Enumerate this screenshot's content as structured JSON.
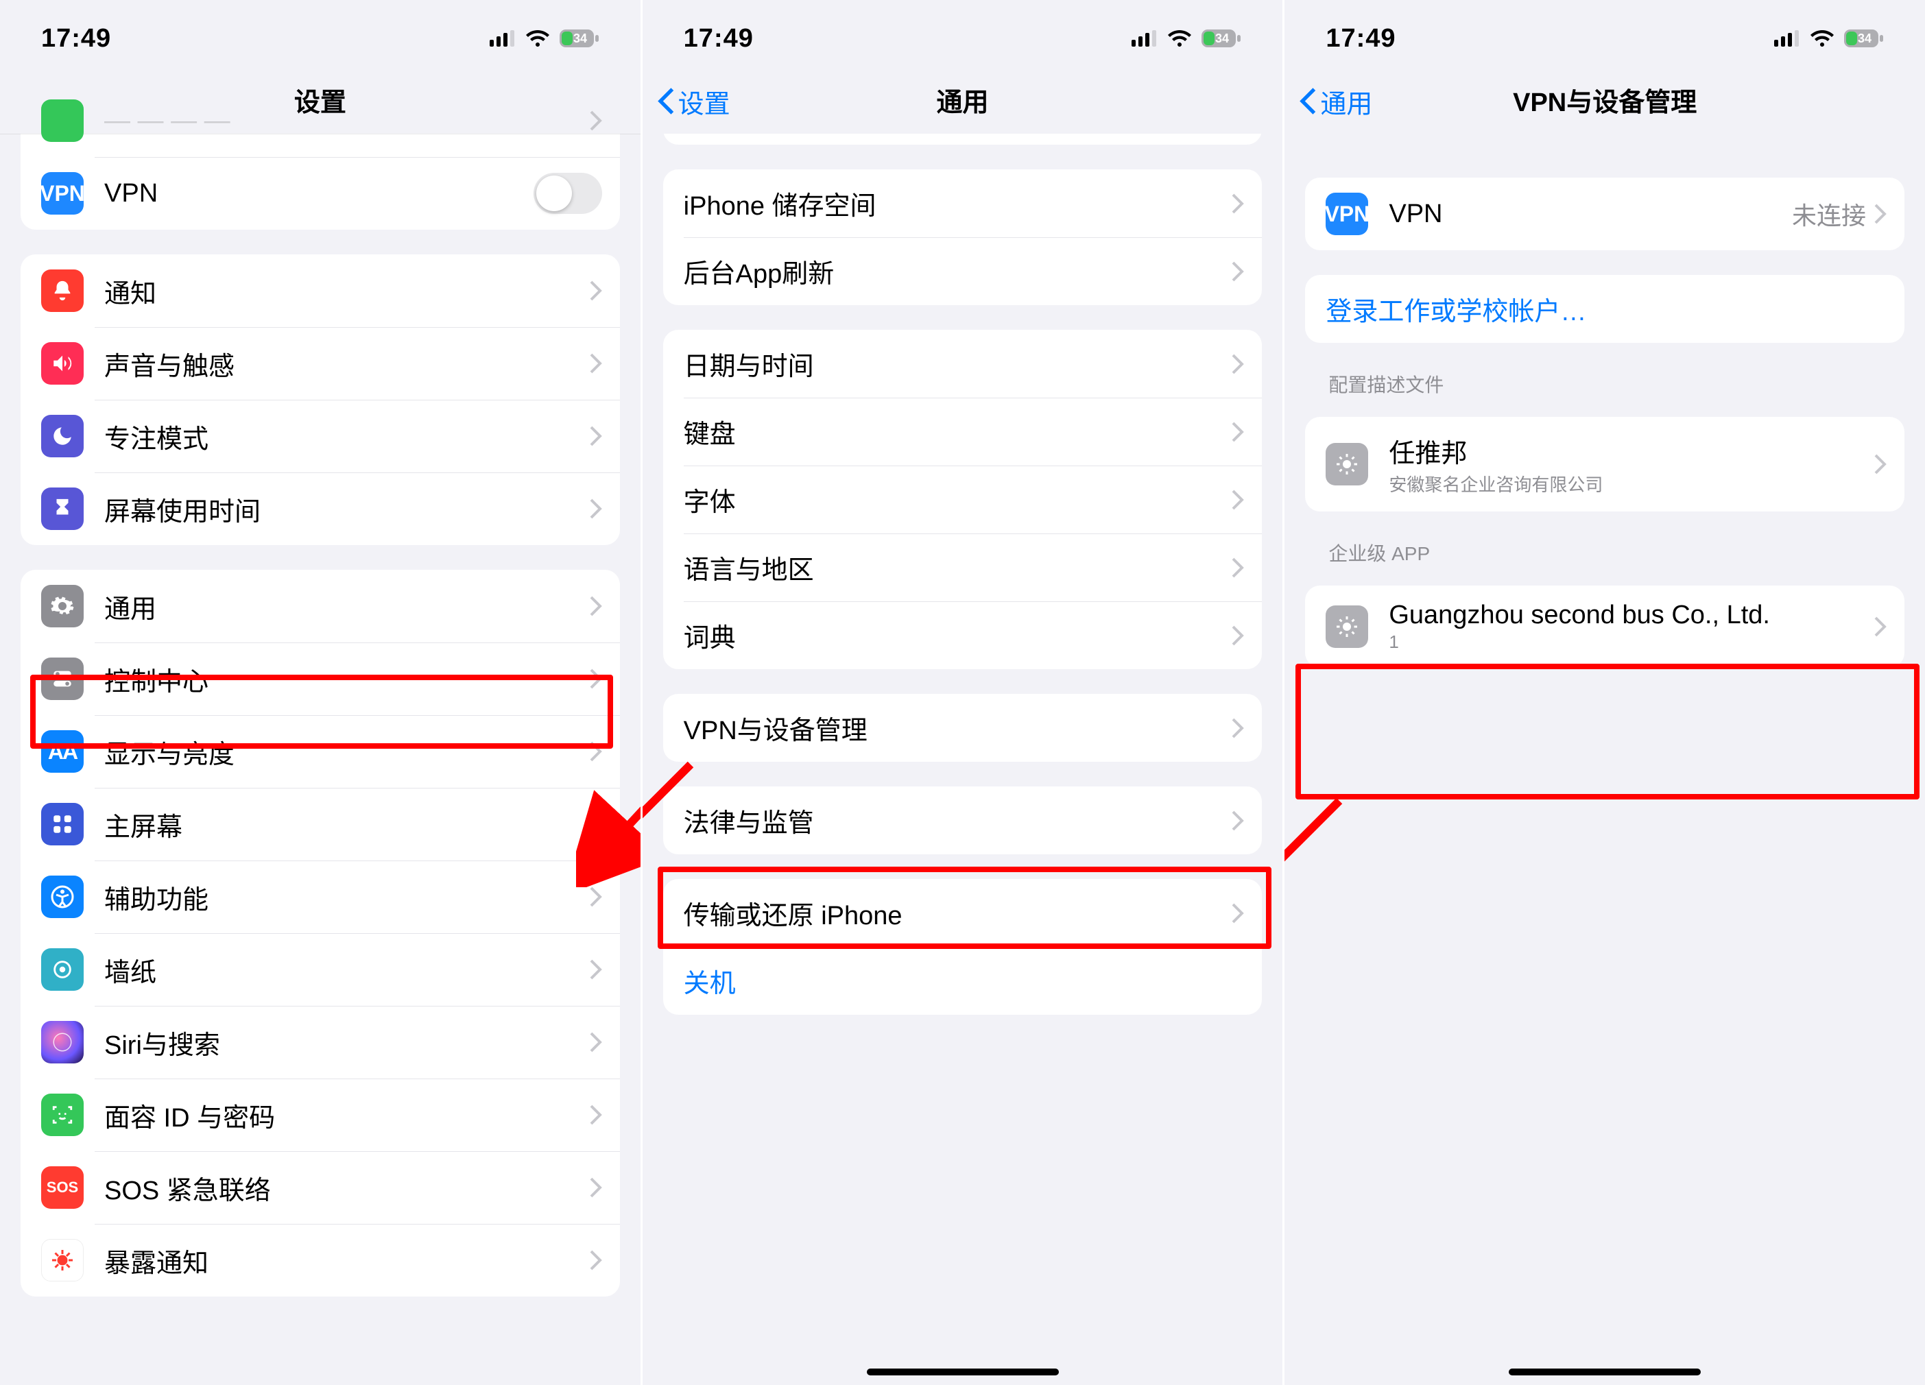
{
  "status": {
    "time": "17:49",
    "battery": "34"
  },
  "screen1": {
    "title": "设置",
    "vpn_row_label": "VPN",
    "group2": {
      "notifications": "通知",
      "sound": "声音与触感",
      "focus": "专注模式",
      "screentime": "屏幕使用时间"
    },
    "group3": {
      "general": "通用",
      "controlcenter": "控制中心",
      "display": "显示与亮度",
      "homescreen": "主屏幕",
      "accessibility": "辅助功能",
      "wallpaper": "墙纸",
      "siri": "Siri与搜索",
      "faceid": "面容 ID 与密码",
      "sos": "SOS 紧急联络",
      "exposure": "暴露通知"
    }
  },
  "screen2": {
    "back": "设置",
    "title": "通用",
    "group1": {
      "storage": "iPhone 储存空间",
      "bgrefresh": "后台App刷新"
    },
    "group2": {
      "datetime": "日期与时间",
      "keyboard": "键盘",
      "font": "字体",
      "lang": "语言与地区",
      "dict": "词典"
    },
    "group3": {
      "vpn": "VPN与设备管理"
    },
    "group4": {
      "legal": "法律与监管"
    },
    "group5": {
      "transfer": "传输或还原 iPhone",
      "shutdown": "关机"
    }
  },
  "screen3": {
    "back": "通用",
    "title": "VPN与设备管理",
    "vpn_label": "VPN",
    "vpn_status": "未连接",
    "signin": "登录工作或学校帐户…",
    "section_profile": "配置描述文件",
    "profile_name": "任推邦",
    "profile_sub": "安徽聚名企业咨询有限公司",
    "section_enterprise": "企业级 APP",
    "enterprise_name": "Guangzhou second bus Co., Ltd.",
    "enterprise_count": "1"
  }
}
